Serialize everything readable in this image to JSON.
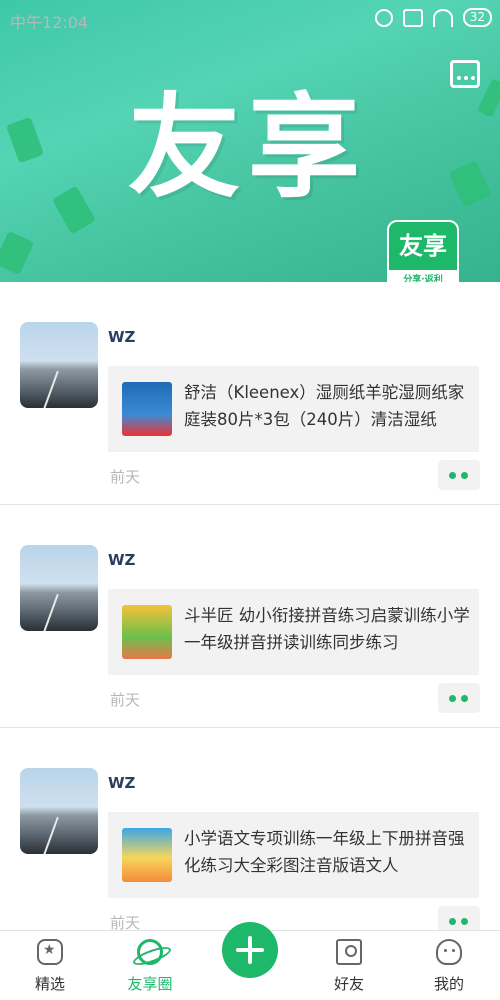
{
  "status_bar": {
    "time": "中午12:04",
    "battery": "32",
    "icons": [
      "mute-icon",
      "close-box-icon",
      "wifi-icon",
      "battery-icon"
    ]
  },
  "header": {
    "title": "友享",
    "logo_top": "友享",
    "logo_bottom": "分享·返利",
    "message_icon": "message-icon"
  },
  "feed": {
    "posts": [
      {
        "username": "WZ",
        "product_title": "舒洁（Kleenex）湿厕纸羊驼湿厕纸家庭装80片*3包（240片）清洁湿纸",
        "time": "前天"
      },
      {
        "username": "WZ",
        "product_title": "斗半匠 幼小衔接拼音练习启蒙训练小学一年级拼音拼读训练同步练习",
        "time": "前天"
      },
      {
        "username": "WZ",
        "product_title": "小学语文专项训练一年级上下册拼音强化练习大全彩图注音版语文人",
        "time": "前天"
      }
    ]
  },
  "tabbar": {
    "tabs": [
      {
        "label": "精选",
        "icon": "star-badge-icon"
      },
      {
        "label": "友享圈",
        "icon": "planet-icon"
      },
      {
        "label": "好友",
        "icon": "contact-card-icon"
      },
      {
        "label": "我的",
        "icon": "profile-icon"
      }
    ],
    "add_icon": "plus-icon"
  },
  "colors": {
    "accent": "#1db86a",
    "header_bg": "#43c09c"
  }
}
